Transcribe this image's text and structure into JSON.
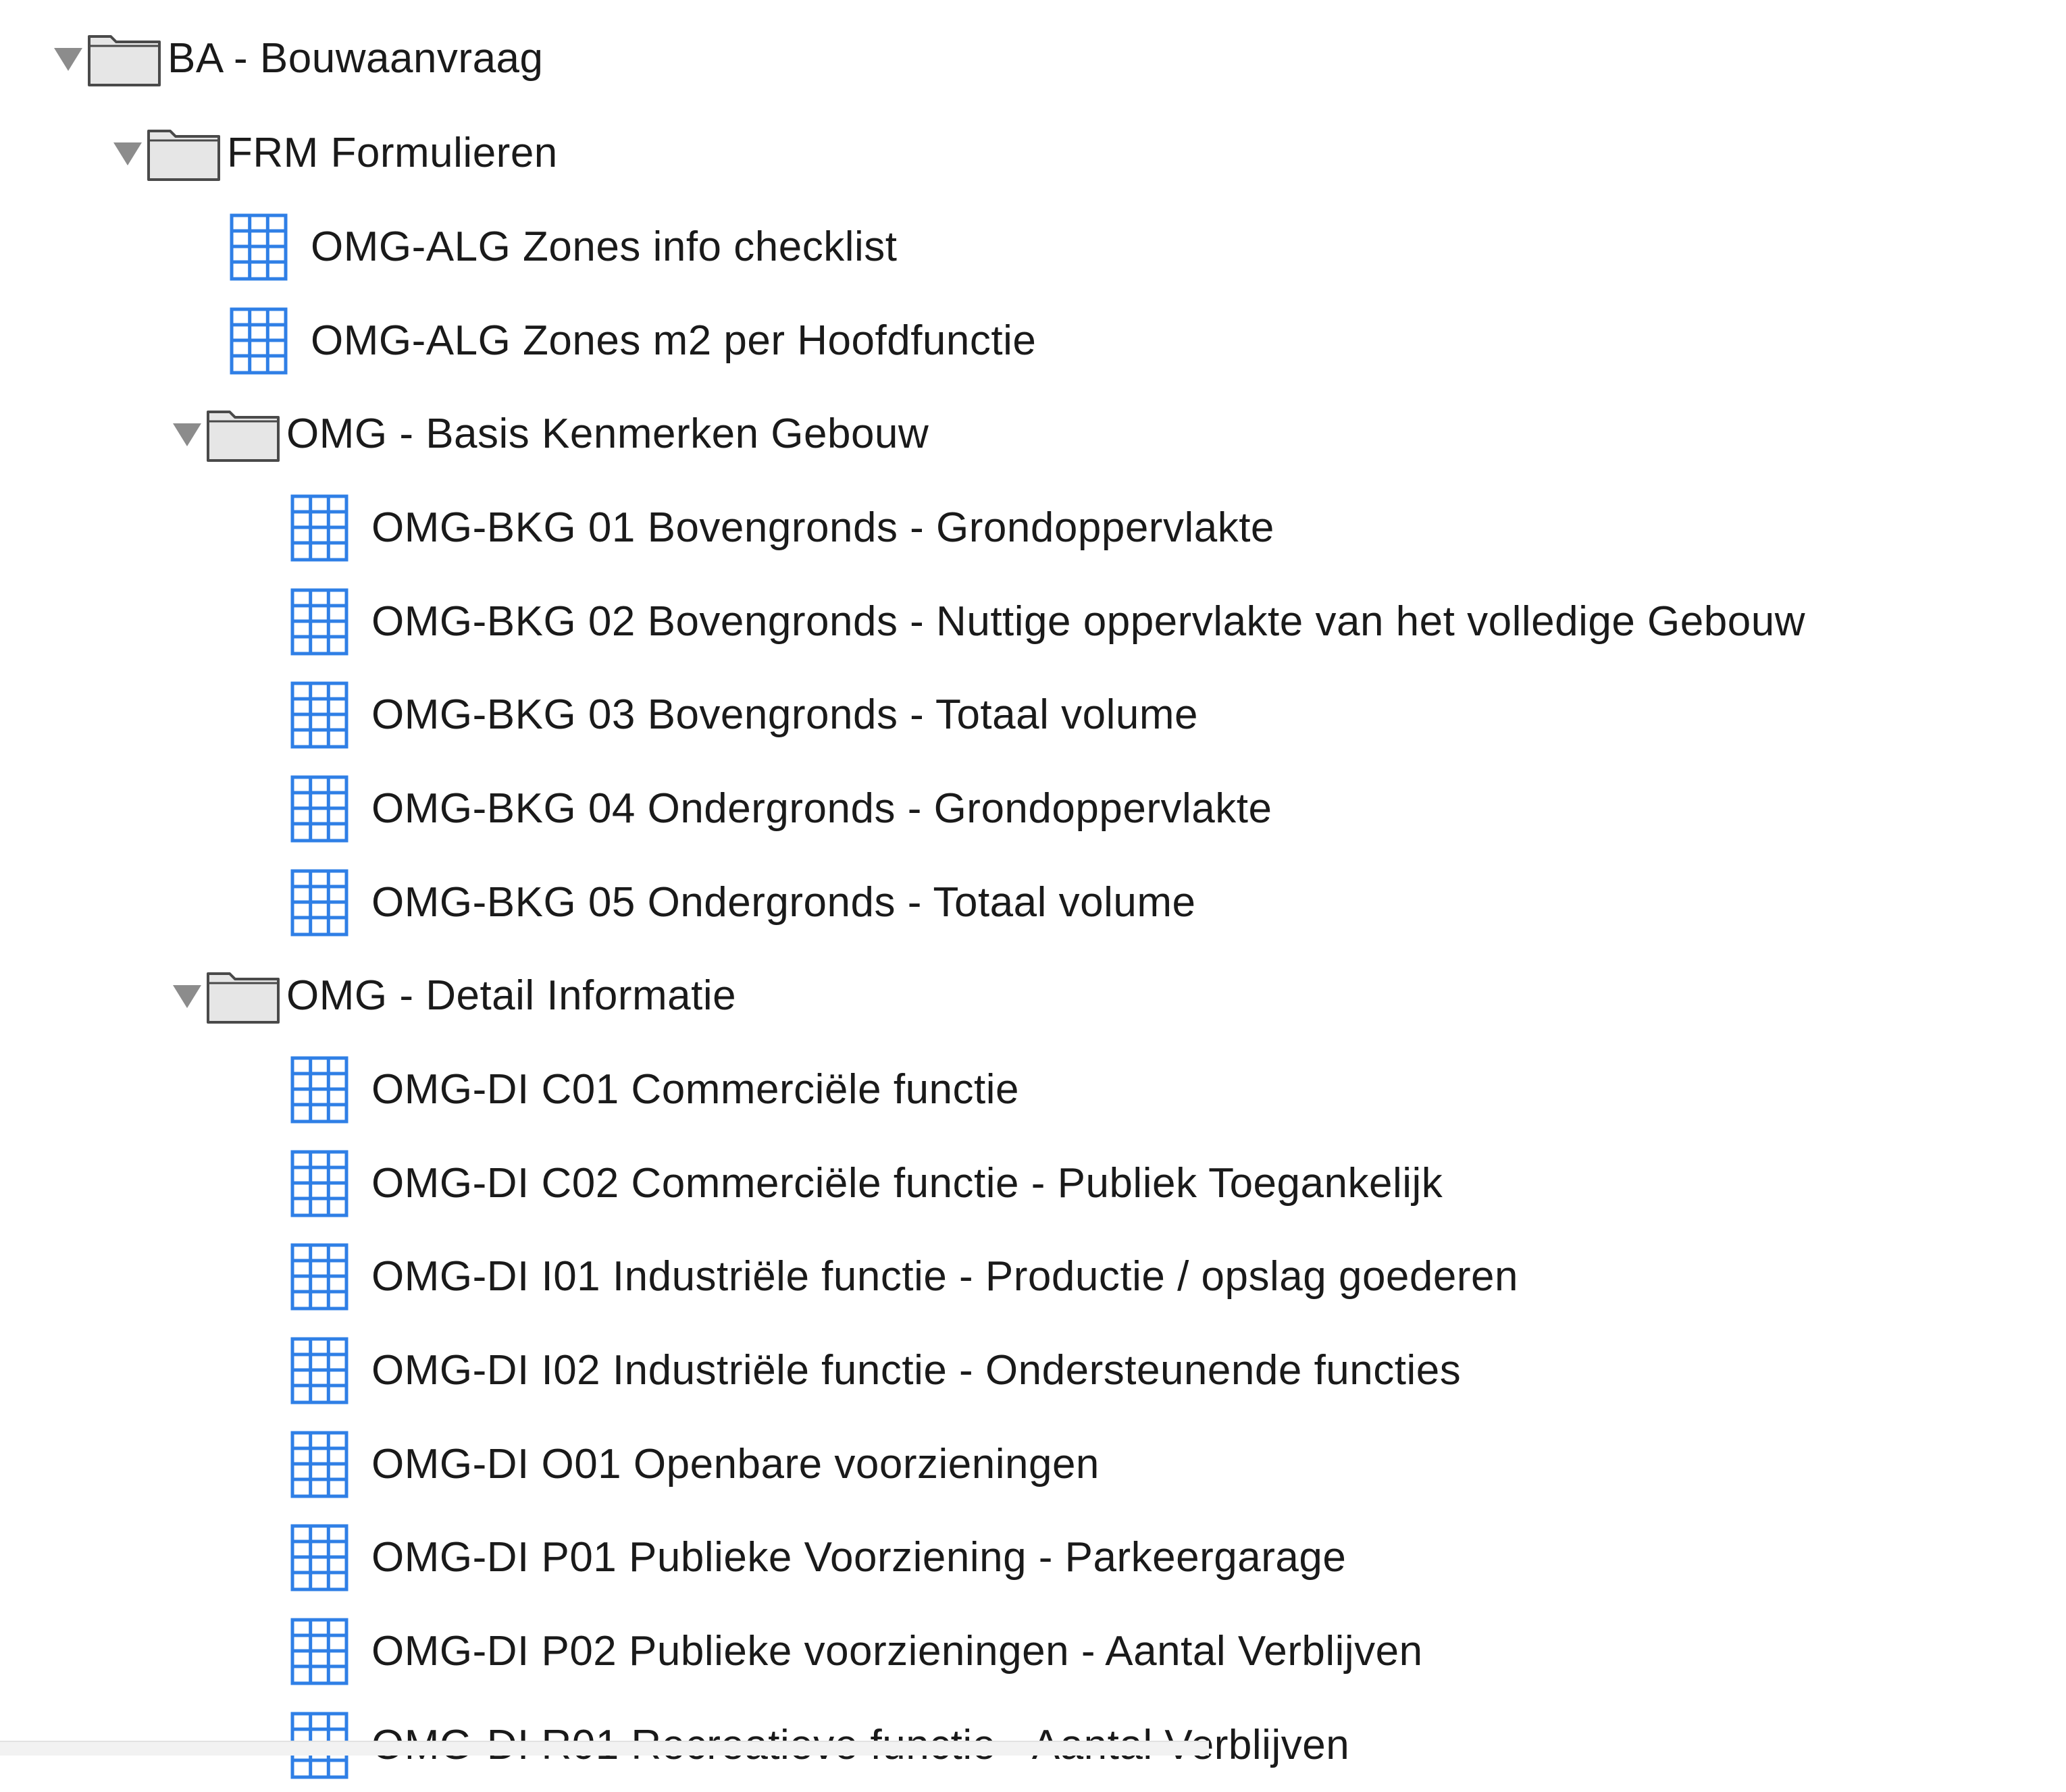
{
  "icons": {
    "folder": "folder-icon",
    "sheet": "spreadsheet-icon",
    "disclosure": "disclosure-triangle-expanded-icon"
  },
  "colors": {
    "sheet_blue": "#2f7fe6",
    "folder_stroke": "#4a4a4a",
    "folder_fill": "#e6e6e6",
    "triangle": "#8c8c8c"
  },
  "tree": {
    "root": {
      "label": "BA - Bouwaanvraag",
      "expanded": true
    },
    "frm": {
      "label": "FRM Formulieren",
      "expanded": true
    },
    "alg_items": [
      "OMG-ALG Zones info checklist",
      "OMG-ALG Zones m2 per Hoofdfunctie"
    ],
    "basis": {
      "label": "OMG - Basis Kenmerken Gebouw",
      "expanded": true,
      "items": [
        "OMG-BKG 01 Bovengronds - Grondoppervlakte",
        "OMG-BKG 02 Bovengronds - Nuttige oppervlakte van het volledige Gebouw",
        "OMG-BKG 03 Bovengronds - Totaal volume",
        "OMG-BKG 04 Ondergronds - Grondoppervlakte",
        "OMG-BKG 05 Ondergronds - Totaal volume"
      ]
    },
    "detail": {
      "label": "OMG - Detail Informatie",
      "expanded": true,
      "items": [
        "OMG-DI C01 Commerciële functie",
        "OMG-DI C02 Commerciële functie - Publiek Toegankelijk",
        "OMG-DI I01 Industriële functie - Productie / opslag goederen",
        "OMG-DI I02 Industriële functie - Ondersteunende functies",
        "OMG-DI O01 Openbare voorzieningen",
        "OMG-DI P01 Publieke Voorziening - Parkeergarage",
        "OMG-DI P02 Publieke voorzieningen - Aantal Verblijven",
        "OMG-DI R01 Recreatieve functie - Aantal Verblijven"
      ]
    }
  }
}
